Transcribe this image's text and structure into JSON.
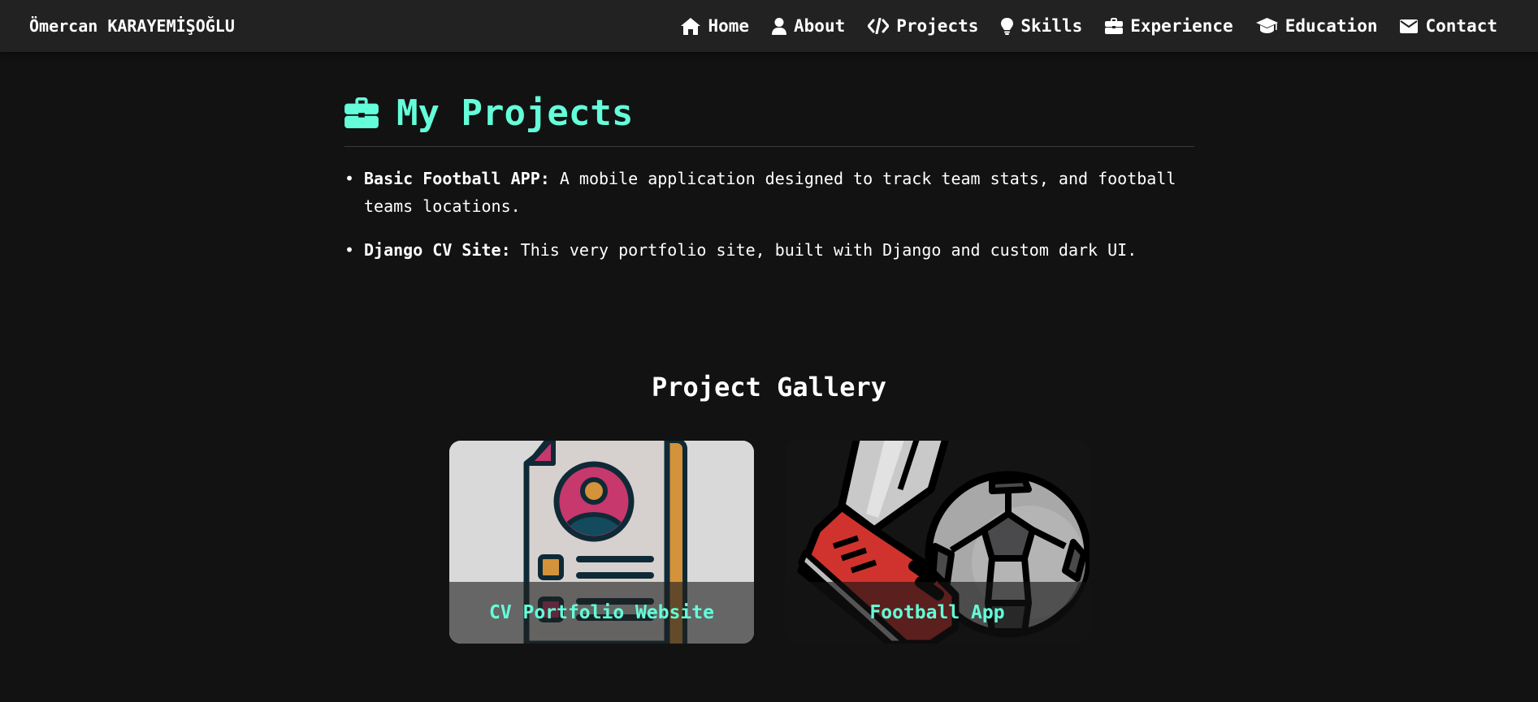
{
  "navbar": {
    "brand": "Ömercan KARAYEMİŞOĞLU",
    "links": [
      {
        "label": "Home",
        "icon": "home-icon"
      },
      {
        "label": "About",
        "icon": "user-icon"
      },
      {
        "label": "Projects",
        "icon": "code-icon"
      },
      {
        "label": "Skills",
        "icon": "lightbulb-icon"
      },
      {
        "label": "Experience",
        "icon": "briefcase-icon"
      },
      {
        "label": "Education",
        "icon": "graduation-cap-icon"
      },
      {
        "label": "Contact",
        "icon": "envelope-icon"
      }
    ]
  },
  "projects": {
    "title": "My Projects",
    "title_icon": "briefcase-icon",
    "items": [
      {
        "bullet": "•",
        "name": "Basic Football APP:",
        "description": " A mobile application designed to track team stats, and football teams locations."
      },
      {
        "bullet": "•",
        "name": "Django CV Site:",
        "description": " This very portfolio site, built with Django and custom dark UI."
      }
    ]
  },
  "gallery": {
    "title": "Project Gallery",
    "cards": [
      {
        "caption": "CV Portfolio Website",
        "image": "cv-document-illustration"
      },
      {
        "caption": "Football App",
        "image": "football-boot-and-ball-illustration"
      }
    ]
  },
  "colors": {
    "accent": "#64ffda",
    "background": "#121212",
    "navbar": "#222222"
  }
}
